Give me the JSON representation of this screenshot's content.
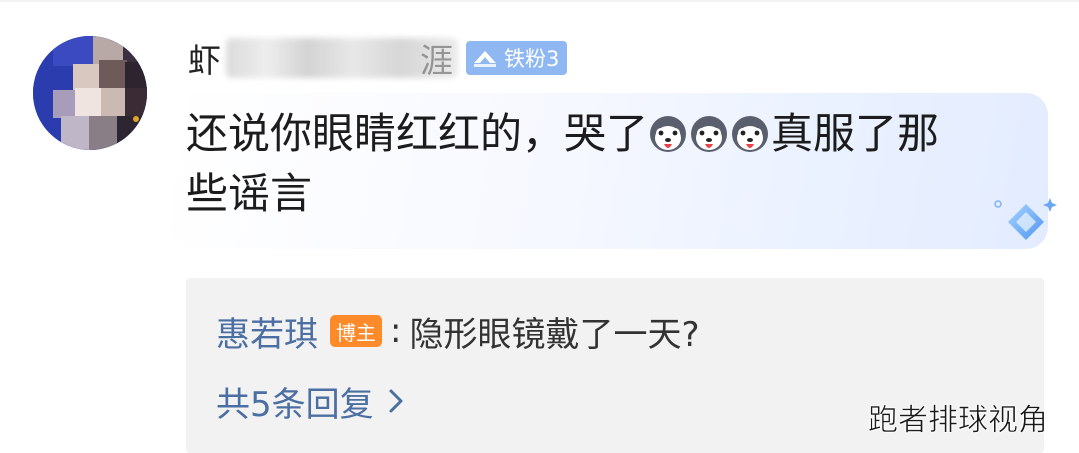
{
  "comment": {
    "username_visible_char": "虾",
    "username_tail": "涯",
    "fan_badge": "铁粉3",
    "text_line1_before_emoji": "还说你眼睛红红的，哭了",
    "emojis": [
      "husky-emoji",
      "husky-emoji",
      "husky-emoji"
    ],
    "text_after_emoji": "真服了那",
    "text_line2": "些谣言"
  },
  "reply": {
    "author": "惠若琪",
    "author_badge": "博主",
    "separator": ":",
    "content": "隐形眼镜戴了一天?",
    "count_label": "共5条回复"
  },
  "watermark": "跑者排球视角",
  "colors": {
    "link_blue": "#4b6fa3",
    "blogger_orange": "#ff8a2a",
    "fan_badge_blue": "#8fb8f2",
    "reply_bg": "#f2f2f2"
  }
}
